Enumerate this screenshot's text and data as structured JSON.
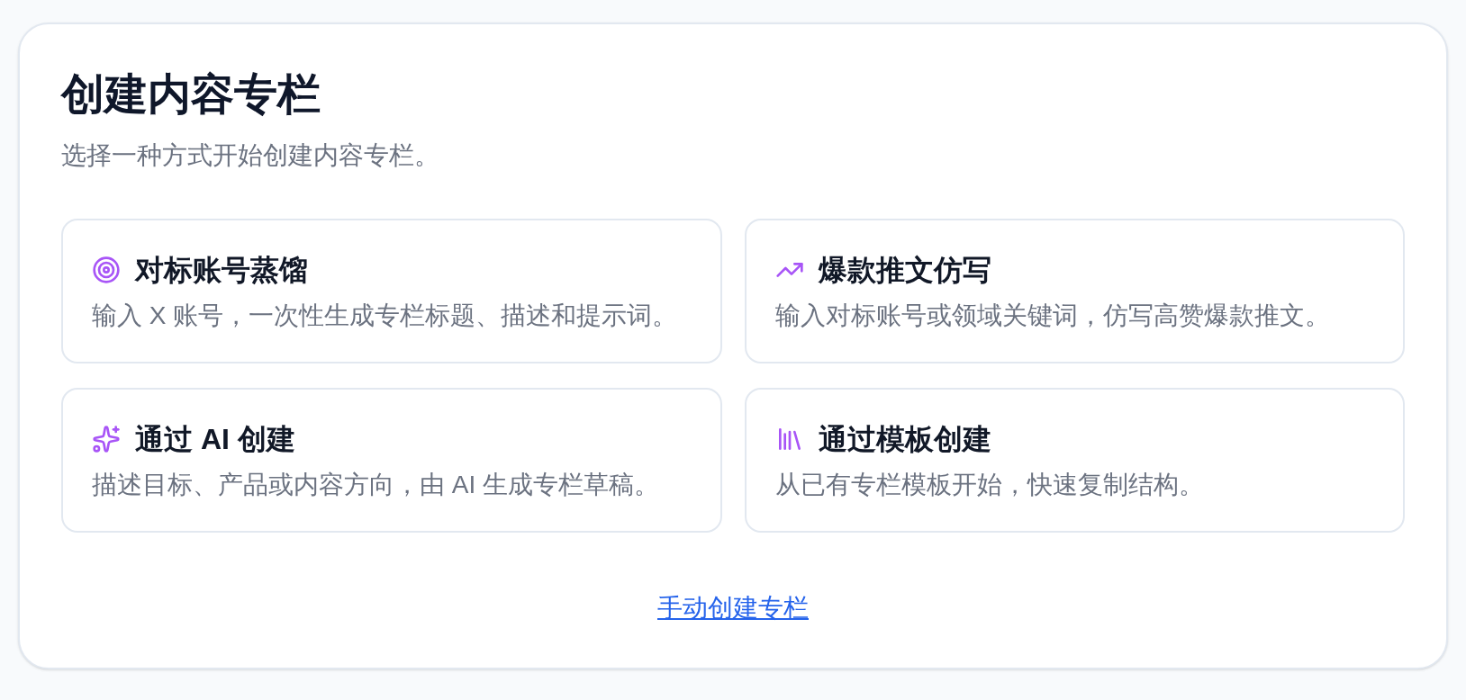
{
  "header": {
    "title": "创建内容专栏",
    "subtitle": "选择一种方式开始创建内容专栏。"
  },
  "options": [
    {
      "title": "对标账号蒸馏",
      "description": "输入 X 账号，一次性生成专栏标题、描述和提示词。"
    },
    {
      "title": "爆款推文仿写",
      "description": "输入对标账号或领域关键词，仿写高赞爆款推文。"
    },
    {
      "title": "通过 AI 创建",
      "description": "描述目标、产品或内容方向，由 AI 生成专栏草稿。"
    },
    {
      "title": "通过模板创建",
      "description": "从已有专栏模板开始，快速复制结构。"
    }
  ],
  "manual_link": "手动创建专栏"
}
